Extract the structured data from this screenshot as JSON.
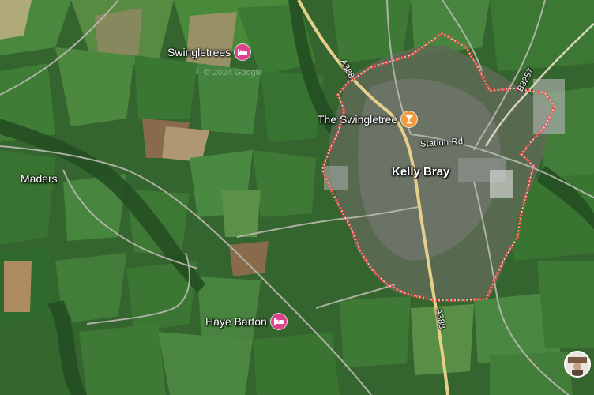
{
  "map": {
    "watermark": "© 2024 Google",
    "colors": {
      "boundary": "#ff4b4b",
      "major_road": "#e6cf8a",
      "minor_road": "#b9b9b0",
      "hotel_pin": "#e0408a",
      "bar_pin": "#f29a3b",
      "field": "#3f7a36"
    }
  },
  "places": {
    "town": "Kelly Bray",
    "village": "Maders"
  },
  "streets": {
    "station_rd": "Station Rd"
  },
  "roads": {
    "a388_north": "A388",
    "a388_south": "A388",
    "b3257": "B3257"
  },
  "pois": [
    {
      "name": "Swingletrees",
      "icon": "hotel-bed-icon"
    },
    {
      "name": "The Swingletree",
      "icon": "cocktail-bar-icon"
    },
    {
      "name": "Haye Barton",
      "icon": "hotel-bed-icon"
    }
  ],
  "user": {
    "avatar": "user-avatar-icon"
  }
}
